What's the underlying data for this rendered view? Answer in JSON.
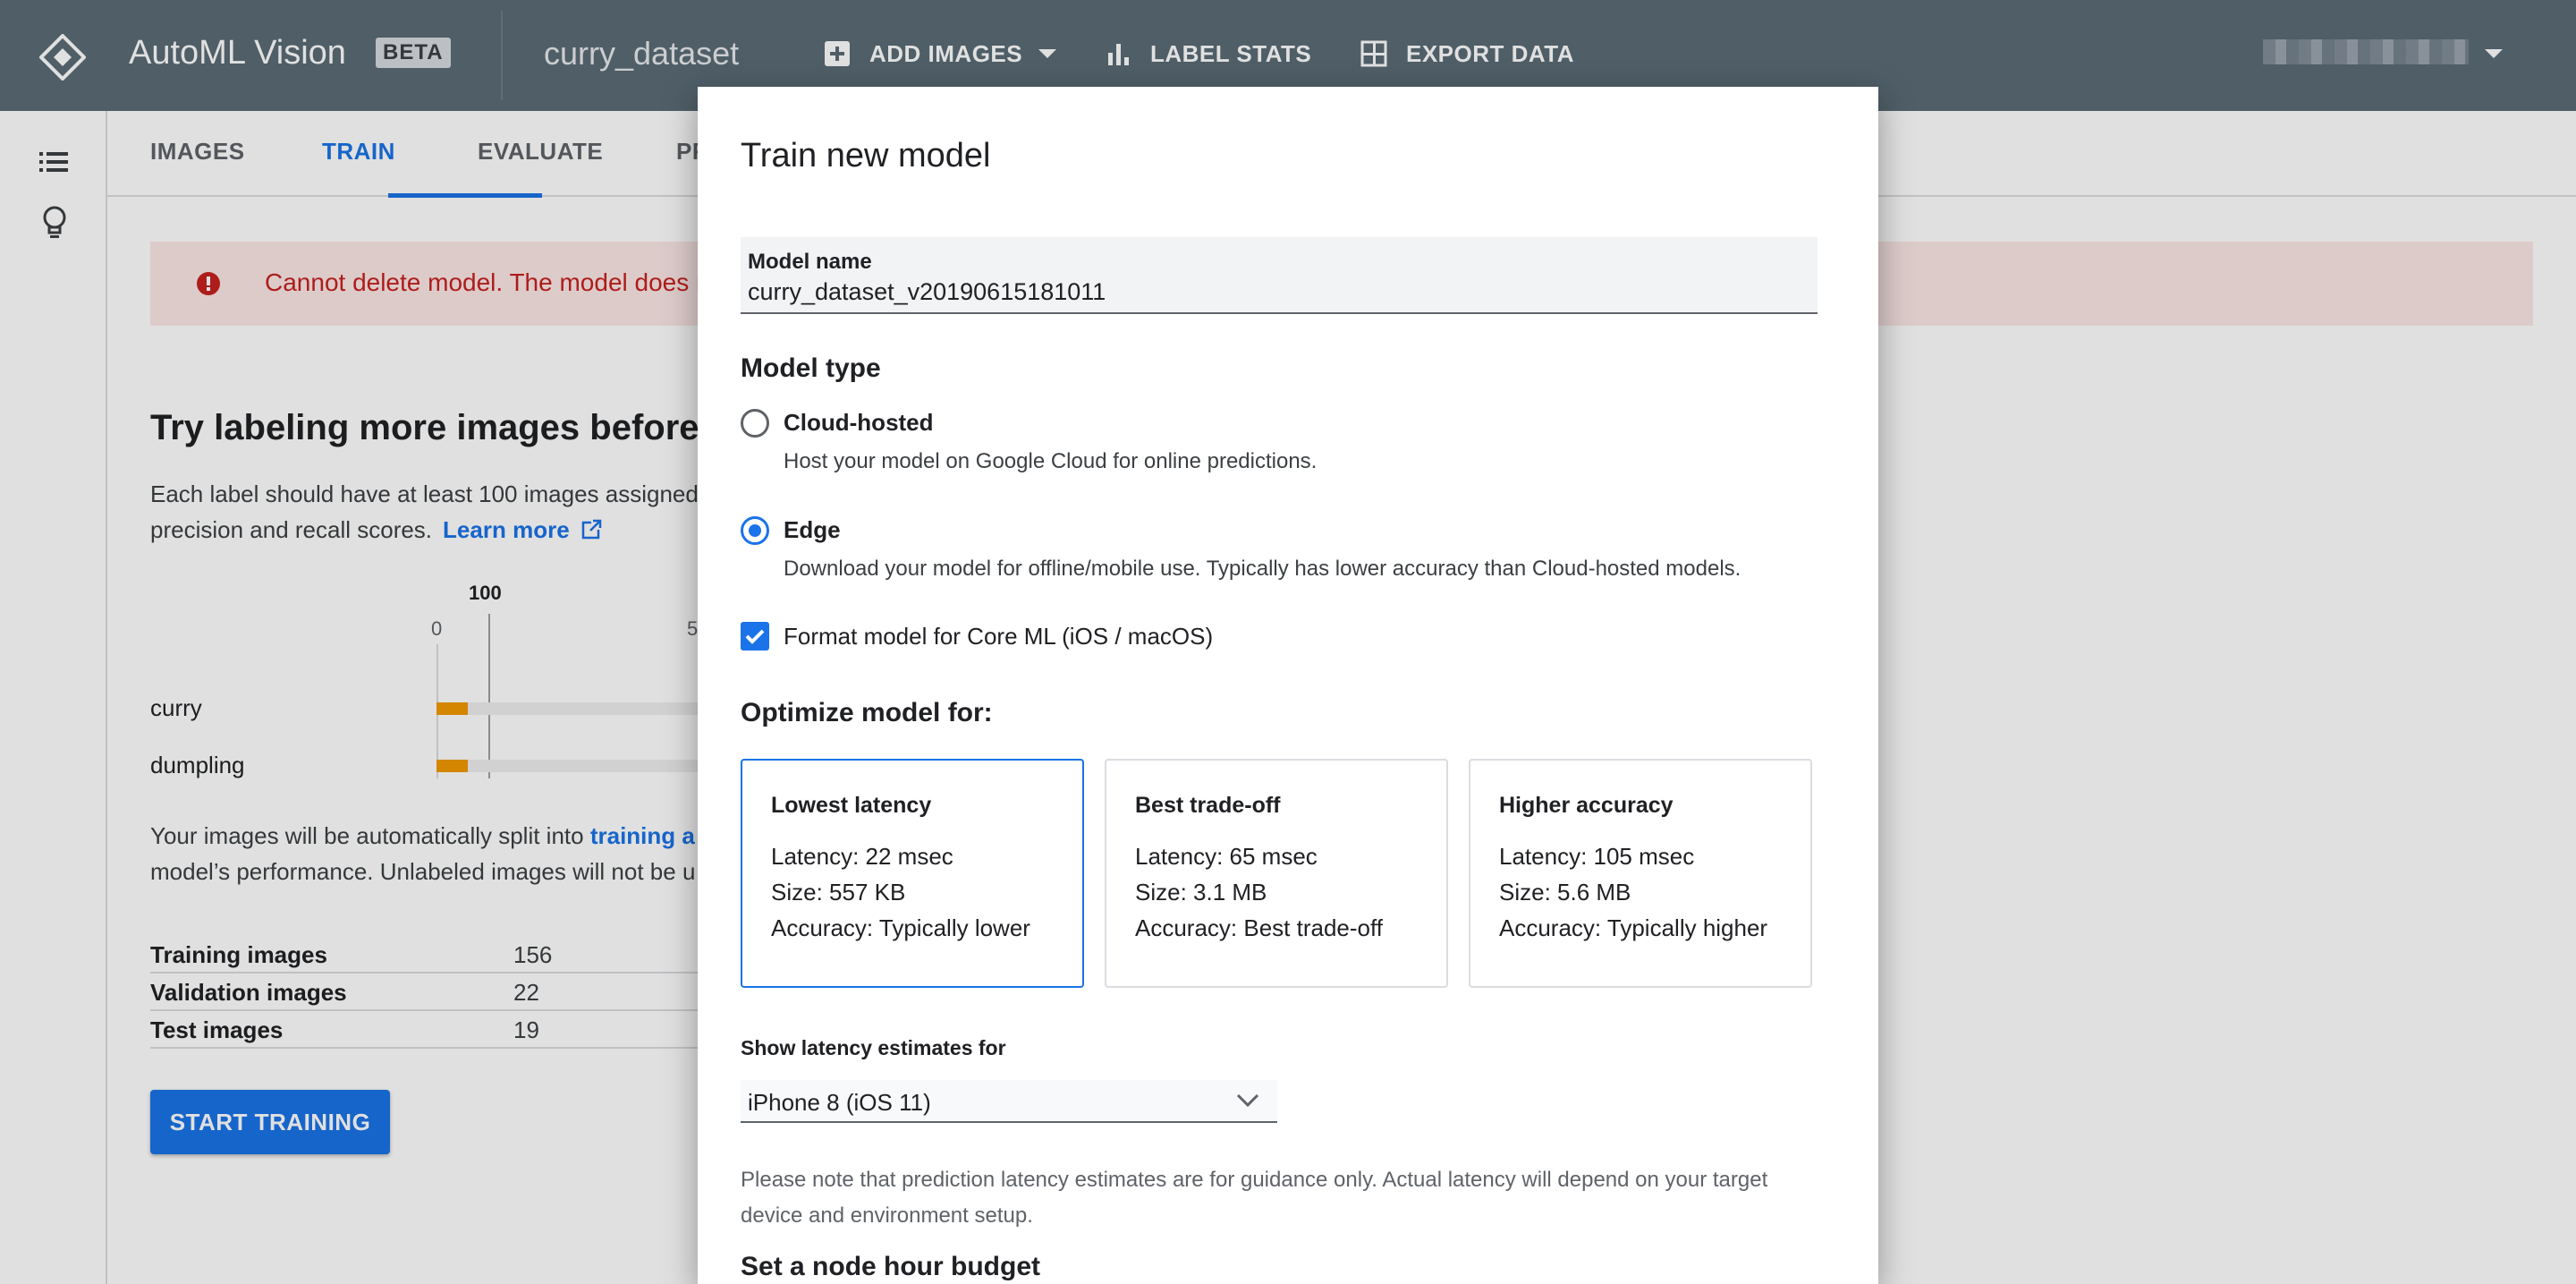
{
  "header": {
    "app_title": "AutoML Vision",
    "beta_badge": "BETA",
    "dataset_name": "curry_dataset",
    "add_images_label": "ADD IMAGES",
    "label_stats_label": "LABEL STATS",
    "export_data_label": "EXPORT DATA"
  },
  "tabs": [
    {
      "label": "IMAGES"
    },
    {
      "label": "TRAIN"
    },
    {
      "label": "EVALUATE"
    },
    {
      "label": "PR"
    }
  ],
  "alert": {
    "text": "Cannot delete model. The model does no"
  },
  "train_page": {
    "heading": "Try labeling more images before t",
    "para_line1": "Each label should have at least 100 images assigned",
    "para_line2": "precision and recall scores.",
    "learn_more": "Learn more",
    "chart_top_label": "100",
    "tick_0": "0",
    "tick_5": "5",
    "split_line1_prefix": "Your images will be automatically split into ",
    "split_line1_link": "training a",
    "split_line2": "model’s performance. Unlabeled images will not be u",
    "split_rows": [
      {
        "label": "Training images",
        "value": "156"
      },
      {
        "label": "Validation images",
        "value": "22"
      },
      {
        "label": "Test images",
        "value": "19"
      }
    ],
    "start_training": "START TRAINING"
  },
  "chart_data": {
    "type": "bar",
    "categories": [
      "curry",
      "dumpling"
    ],
    "series": [
      {
        "values": [
          60,
          60
        ]
      }
    ],
    "reference_line": 100,
    "tick_labels": [
      "0",
      "5"
    ]
  },
  "dialog": {
    "title": "Train new model",
    "model_name_label": "Model name",
    "model_name_value": "curry_dataset_v20190615181011",
    "model_type_heading": "Model type",
    "cloud_title": "Cloud-hosted",
    "cloud_desc": "Host your model on Google Cloud for online predictions.",
    "edge_title": "Edge",
    "edge_desc": "Download your model for offline/mobile use. Typically has lower accuracy than Cloud-hosted models.",
    "selected_model_type": "Edge",
    "coreml_label": "Format model for Core ML (iOS / macOS)",
    "coreml_checked": true,
    "optimize_heading": "Optimize model for:",
    "options": [
      {
        "title": "Lowest latency",
        "latency": "Latency: 22 msec",
        "size": "Size: 557 KB",
        "accuracy": "Accuracy: Typically lower",
        "selected": true
      },
      {
        "title": "Best trade-off",
        "latency": "Latency: 65 msec",
        "size": "Size: 3.1 MB",
        "accuracy": "Accuracy: Best trade-off",
        "selected": false
      },
      {
        "title": "Higher accuracy",
        "latency": "Latency: 105 msec",
        "size": "Size: 5.6 MB",
        "accuracy": "Accuracy: Typically higher",
        "selected": false
      }
    ],
    "device_label": "Show latency estimates for",
    "device_value": "iPhone 8 (iOS 11)",
    "note": "Please note that prediction latency estimates are for guidance only. Actual latency will depend on your target device and environment setup.",
    "budget_heading": "Set a node hour budget"
  },
  "colors": {
    "topbar": "#5b6b76",
    "accent": "#1a73e8",
    "bar": "#f29900",
    "alert_bg": "#fce8e6",
    "alert_text": "#c5221f"
  }
}
